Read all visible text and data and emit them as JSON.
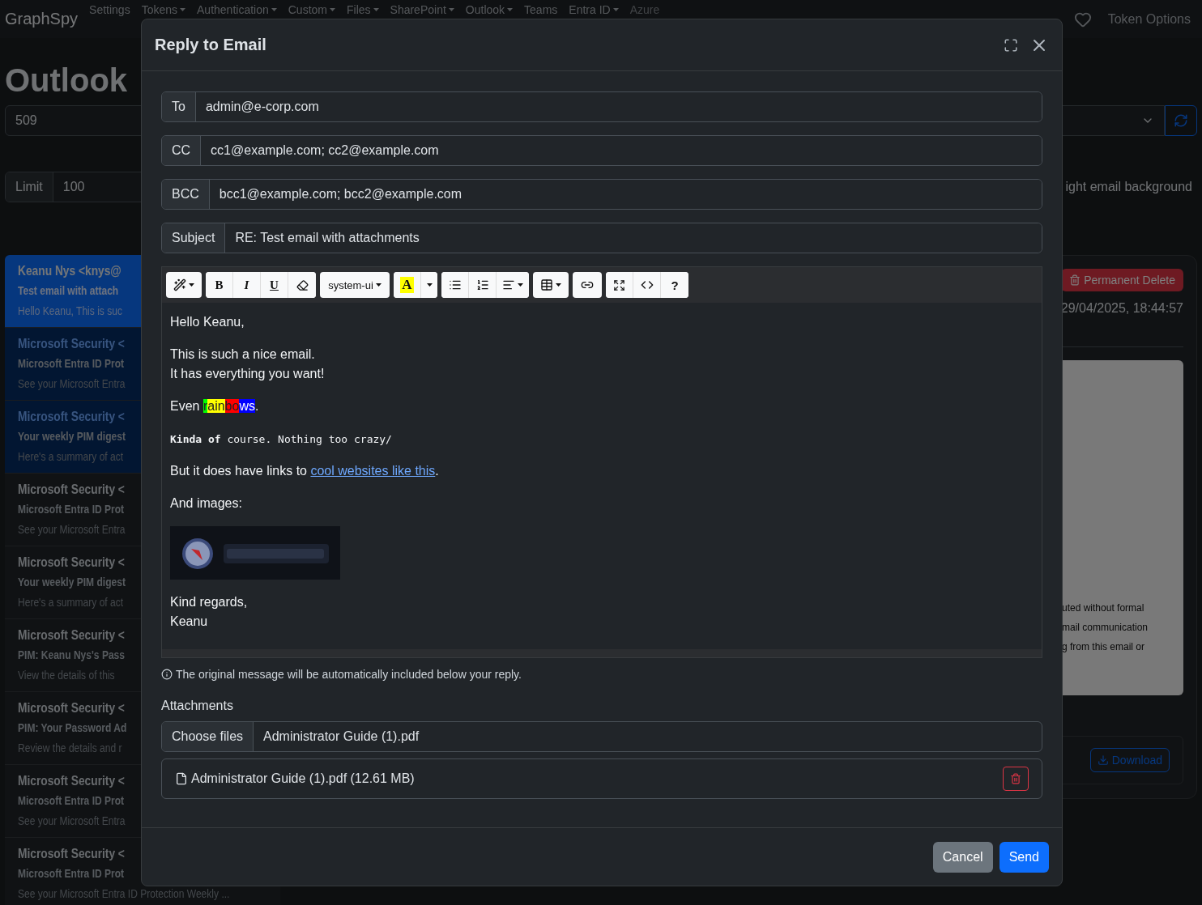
{
  "navbar": {
    "brand": "GraphSpy",
    "items": [
      {
        "label": "Settings",
        "dropdown": false,
        "disabled": false
      },
      {
        "label": "Tokens",
        "dropdown": true,
        "disabled": false
      },
      {
        "label": "Authentication",
        "dropdown": true,
        "disabled": false
      },
      {
        "label": "Custom",
        "dropdown": true,
        "disabled": false
      },
      {
        "label": "Files",
        "dropdown": true,
        "disabled": false
      },
      {
        "label": "SharePoint",
        "dropdown": true,
        "disabled": false
      },
      {
        "label": "Outlook",
        "dropdown": true,
        "disabled": false
      },
      {
        "label": "Teams",
        "dropdown": false,
        "disabled": false
      },
      {
        "label": "Entra ID",
        "dropdown": true,
        "disabled": false
      },
      {
        "label": "Azure",
        "dropdown": false,
        "disabled": true
      }
    ],
    "token_options": "Token Options"
  },
  "page": {
    "title": "Outlook",
    "count_field": "509",
    "limit_label": "Limit",
    "limit_value": "100",
    "option_label": "ight email background",
    "emails": [
      {
        "sender": "Keanu Nys <knys@",
        "subject": "Test email with attach",
        "preview": "Hello Keanu, This is suc",
        "selected": true,
        "unread": false
      },
      {
        "sender": "Microsoft Security <",
        "subject": "Microsoft Entra ID Prot",
        "preview": "See your Microsoft Entra",
        "selected": false,
        "unread": true
      },
      {
        "sender": "Microsoft Security <",
        "subject": "Your weekly PIM digest",
        "preview": "Here's a summary of act",
        "selected": false,
        "unread": true
      },
      {
        "sender": "Microsoft Security <",
        "subject": "Microsoft Entra ID Prot",
        "preview": "See your Microsoft Entra",
        "selected": false,
        "unread": false
      },
      {
        "sender": "Microsoft Security <",
        "subject": "Your weekly PIM digest",
        "preview": "Here's a summary of act",
        "selected": false,
        "unread": false
      },
      {
        "sender": "Microsoft Security <",
        "subject": "PIM: Keanu Nys's Pass",
        "preview": "View the details of this",
        "selected": false,
        "unread": false
      },
      {
        "sender": "Microsoft Security <",
        "subject": "PIM: Your Password Ad",
        "preview": "Review the details and r",
        "selected": false,
        "unread": false
      },
      {
        "sender": "Microsoft Security <",
        "subject": "Microsoft Entra ID Prot",
        "preview": "See your Microsoft Entra",
        "selected": false,
        "unread": false
      },
      {
        "sender": "Microsoft Security <",
        "subject": "Microsoft Entra ID Prot",
        "preview": "See your Microsoft Entra ID Protection Weekly ...",
        "selected": false,
        "unread": false
      }
    ],
    "detail": {
      "delete_button": "Permanent Delete",
      "date": "29/04/2025, 18:44:57",
      "body_lines": [
        "uted without formal",
        "mail communication",
        "g from this email or"
      ],
      "download_button": "Download"
    }
  },
  "modal": {
    "title": "Reply to Email",
    "fields": [
      {
        "label": "To",
        "value": "admin@e-corp.com"
      },
      {
        "label": "CC",
        "value": "cc1@example.com; cc2@example.com"
      },
      {
        "label": "BCC",
        "value": "bcc1@example.com; bcc2@example.com"
      },
      {
        "label": "Subject",
        "value": "RE: Test email with attachments"
      }
    ],
    "toolbar": {
      "bold": "B",
      "italic": "I",
      "underline": "U",
      "font": "system-ui",
      "highlight": "A",
      "help": "?"
    },
    "body": [
      {
        "kind": "lines",
        "lines": [
          "Hello Keanu,"
        ]
      },
      {
        "kind": "lines",
        "lines": [
          "This is such a nice email.",
          "It has everything you want!"
        ]
      },
      {
        "kind": "rainbow",
        "before": "Even ",
        "segments": [
          {
            "text": "r",
            "color": "#00ff00"
          },
          {
            "text": "ain",
            "color": "#ffff00"
          },
          {
            "text": "bo",
            "color": "#ff0000"
          },
          {
            "text": "ws",
            "color": "#0000ff"
          }
        ],
        "after": "."
      },
      {
        "kind": "mono",
        "text": "**Kinda of** course. Nothing too crazy/"
      },
      {
        "kind": "link",
        "before": "But it does have links to ",
        "link": "cool websites like this",
        "after": "."
      },
      {
        "kind": "lines",
        "lines": [
          "And images:"
        ]
      },
      {
        "kind": "picture"
      },
      {
        "kind": "lines",
        "lines": [
          "Kind regards,",
          "Keanu"
        ]
      }
    ],
    "note": "The original message will be automatically included below your reply.",
    "attachments_label": "Attachments",
    "choose_button": "Choose files",
    "chosen_file": "Administrator Guide (1).pdf",
    "attachments": [
      {
        "name": "Administrator Guide (1).pdf (12.61 MB)"
      }
    ],
    "cancel": "Cancel",
    "send": "Send"
  }
}
